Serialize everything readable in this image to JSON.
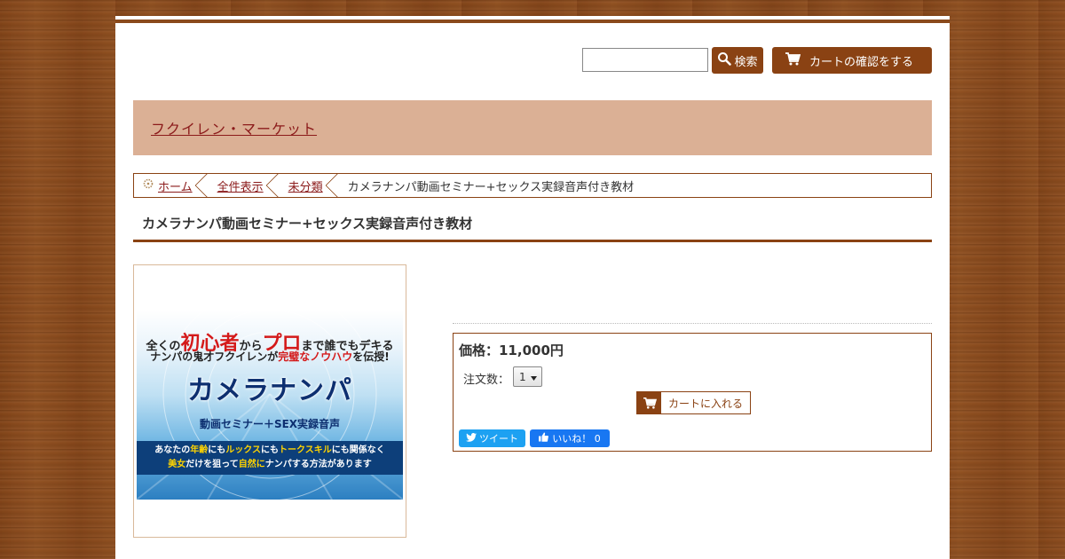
{
  "header": {
    "search_button_label": "検索",
    "cart_check_label": "カートの確認をする",
    "search_value": ""
  },
  "shop": {
    "name": "フクイレン・マーケット"
  },
  "breadcrumb": {
    "items": [
      {
        "label": "ホーム"
      },
      {
        "label": "全件表示"
      },
      {
        "label": "未分類"
      },
      {
        "label": "カメラナンパ動画セミナー+セックス実録音声付き教材"
      }
    ]
  },
  "product": {
    "title": "カメラナンパ動画セミナー+セックス実録音声付き教材",
    "price": "価格：11,000円",
    "qty_label": "注文数：",
    "qty_value": "1",
    "add_to_cart_label": "カートに入れる"
  },
  "promo": {
    "line1_a": "全くの",
    "line1_b": "初心者",
    "line1_c": "から",
    "line1_d": "プロ",
    "line1_e": "まで誰でもデキる",
    "line2_a": "ナンパの鬼才フクイレンが",
    "line2_b": "完璧なノウハウ",
    "line2_c": "を伝授!",
    "main": "カメラナンパ",
    "sub": "動画セミナー＋SEX実録音声",
    "ribbon1_a": "あなたの",
    "ribbon1_b": "年齢",
    "ribbon1_c": "にも",
    "ribbon1_d": "ルックス",
    "ribbon1_e": "にも",
    "ribbon1_f": "トークスキル",
    "ribbon1_g": "にも関係なく",
    "ribbon2_a": "美女",
    "ribbon2_b": "だけを狙って",
    "ribbon2_c": "自然に",
    "ribbon2_d": "ナンパする方法があります"
  },
  "social": {
    "tweet_label": "ツイート",
    "like_label": "いいね！ 0"
  },
  "icons": {
    "search": "magnifier-icon",
    "cart": "cart-icon",
    "home": "home-icon",
    "twitter": "twitter-bird-icon",
    "like": "thumbs-up-icon"
  },
  "colors": {
    "accent": "#8a4213",
    "banner": "#dbb095",
    "link": "#8b1a1a",
    "twitter": "#1da1f2",
    "facebook": "#1877f2"
  }
}
